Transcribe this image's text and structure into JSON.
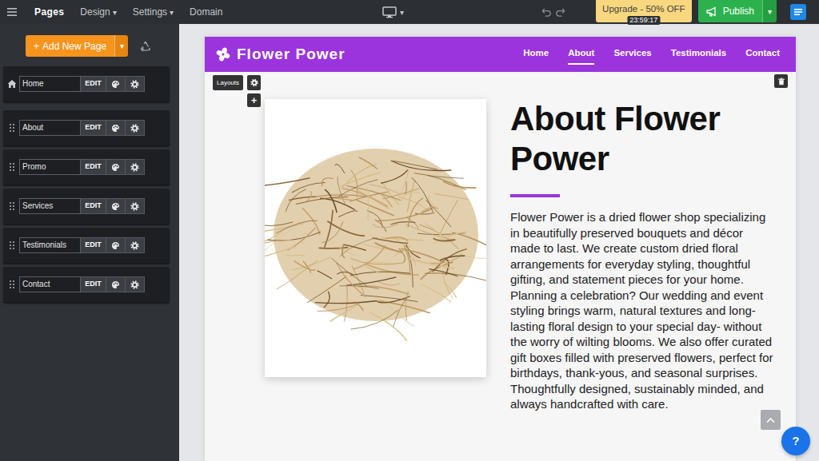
{
  "topbar": {
    "menu_items": [
      {
        "label": "Pages",
        "selected": true
      },
      {
        "label": "Design",
        "caret": "▾",
        "selected": false
      },
      {
        "label": "Settings",
        "caret": "▾",
        "selected": false
      },
      {
        "label": "Domain",
        "selected": false
      }
    ],
    "device_caret": "▾",
    "upgrade": {
      "label": "Upgrade - 50% OFF",
      "timer": "23:59:17"
    },
    "publish": {
      "label": "Publish",
      "caret": "▾"
    }
  },
  "sidebar": {
    "add_page": {
      "icon": "+",
      "label": "Add New Page",
      "caret": "▾"
    },
    "pages": [
      {
        "name": "Home",
        "kind": "home",
        "edit": "EDIT"
      },
      {
        "name": "About",
        "kind": "page",
        "edit": "EDIT"
      },
      {
        "name": "Promo",
        "kind": "page",
        "edit": "EDIT"
      },
      {
        "name": "Services",
        "kind": "page",
        "edit": "EDIT"
      },
      {
        "name": "Testimonials",
        "kind": "page",
        "edit": "EDIT"
      },
      {
        "name": "Contact",
        "kind": "page",
        "edit": "EDIT"
      }
    ]
  },
  "site": {
    "brand": "Flower Power",
    "nav": [
      {
        "label": "Home",
        "selected": false
      },
      {
        "label": "About",
        "selected": true
      },
      {
        "label": "Services",
        "selected": false
      },
      {
        "label": "Testimonials",
        "selected": false
      },
      {
        "label": "Contact",
        "selected": false
      }
    ],
    "editor": {
      "layouts": "Layouts",
      "add": "+"
    },
    "about": {
      "title": "About Flower Power",
      "body": "Flower Power is a dried flower shop specializing in beautifully preserved bouquets and décor made to last. We create custom dried floral arrangements for everyday styling, thoughtful gifting, and statement pieces for your home. Planning a celebration? Our wedding and event styling brings warm, natural textures and long-lasting floral design to your special day- without the worry of wilting blooms. We also offer curated gift boxes filled with preserved flowers, perfect for birthdays, thank-yous, and seasonal surprises. Thoughtfully designed, sustainably minded, and always handcrafted with care."
    }
  },
  "help": {
    "label": "?"
  }
}
